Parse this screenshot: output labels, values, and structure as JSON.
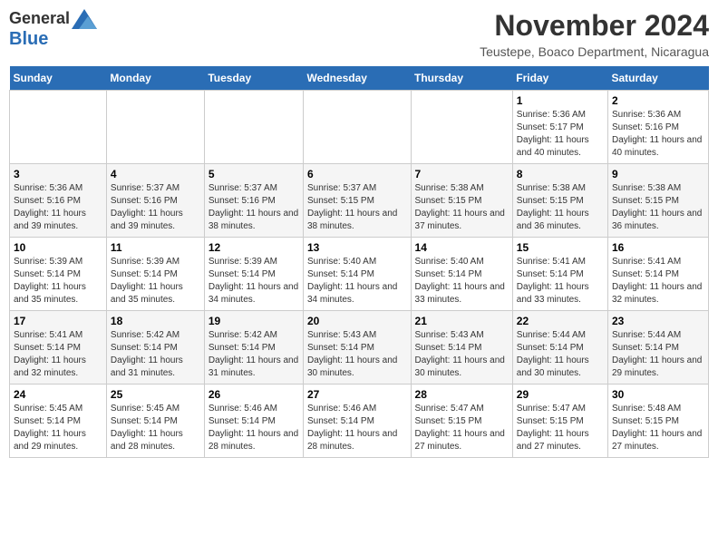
{
  "logo": {
    "line1": "General",
    "line2": "Blue"
  },
  "title": "November 2024",
  "subtitle": "Teustepe, Boaco Department, Nicaragua",
  "weekdays": [
    "Sunday",
    "Monday",
    "Tuesday",
    "Wednesday",
    "Thursday",
    "Friday",
    "Saturday"
  ],
  "weeks": [
    [
      {
        "day": "",
        "info": ""
      },
      {
        "day": "",
        "info": ""
      },
      {
        "day": "",
        "info": ""
      },
      {
        "day": "",
        "info": ""
      },
      {
        "day": "",
        "info": ""
      },
      {
        "day": "1",
        "info": "Sunrise: 5:36 AM\nSunset: 5:17 PM\nDaylight: 11 hours and 40 minutes."
      },
      {
        "day": "2",
        "info": "Sunrise: 5:36 AM\nSunset: 5:16 PM\nDaylight: 11 hours and 40 minutes."
      }
    ],
    [
      {
        "day": "3",
        "info": "Sunrise: 5:36 AM\nSunset: 5:16 PM\nDaylight: 11 hours and 39 minutes."
      },
      {
        "day": "4",
        "info": "Sunrise: 5:37 AM\nSunset: 5:16 PM\nDaylight: 11 hours and 39 minutes."
      },
      {
        "day": "5",
        "info": "Sunrise: 5:37 AM\nSunset: 5:16 PM\nDaylight: 11 hours and 38 minutes."
      },
      {
        "day": "6",
        "info": "Sunrise: 5:37 AM\nSunset: 5:15 PM\nDaylight: 11 hours and 38 minutes."
      },
      {
        "day": "7",
        "info": "Sunrise: 5:38 AM\nSunset: 5:15 PM\nDaylight: 11 hours and 37 minutes."
      },
      {
        "day": "8",
        "info": "Sunrise: 5:38 AM\nSunset: 5:15 PM\nDaylight: 11 hours and 36 minutes."
      },
      {
        "day": "9",
        "info": "Sunrise: 5:38 AM\nSunset: 5:15 PM\nDaylight: 11 hours and 36 minutes."
      }
    ],
    [
      {
        "day": "10",
        "info": "Sunrise: 5:39 AM\nSunset: 5:14 PM\nDaylight: 11 hours and 35 minutes."
      },
      {
        "day": "11",
        "info": "Sunrise: 5:39 AM\nSunset: 5:14 PM\nDaylight: 11 hours and 35 minutes."
      },
      {
        "day": "12",
        "info": "Sunrise: 5:39 AM\nSunset: 5:14 PM\nDaylight: 11 hours and 34 minutes."
      },
      {
        "day": "13",
        "info": "Sunrise: 5:40 AM\nSunset: 5:14 PM\nDaylight: 11 hours and 34 minutes."
      },
      {
        "day": "14",
        "info": "Sunrise: 5:40 AM\nSunset: 5:14 PM\nDaylight: 11 hours and 33 minutes."
      },
      {
        "day": "15",
        "info": "Sunrise: 5:41 AM\nSunset: 5:14 PM\nDaylight: 11 hours and 33 minutes."
      },
      {
        "day": "16",
        "info": "Sunrise: 5:41 AM\nSunset: 5:14 PM\nDaylight: 11 hours and 32 minutes."
      }
    ],
    [
      {
        "day": "17",
        "info": "Sunrise: 5:41 AM\nSunset: 5:14 PM\nDaylight: 11 hours and 32 minutes."
      },
      {
        "day": "18",
        "info": "Sunrise: 5:42 AM\nSunset: 5:14 PM\nDaylight: 11 hours and 31 minutes."
      },
      {
        "day": "19",
        "info": "Sunrise: 5:42 AM\nSunset: 5:14 PM\nDaylight: 11 hours and 31 minutes."
      },
      {
        "day": "20",
        "info": "Sunrise: 5:43 AM\nSunset: 5:14 PM\nDaylight: 11 hours and 30 minutes."
      },
      {
        "day": "21",
        "info": "Sunrise: 5:43 AM\nSunset: 5:14 PM\nDaylight: 11 hours and 30 minutes."
      },
      {
        "day": "22",
        "info": "Sunrise: 5:44 AM\nSunset: 5:14 PM\nDaylight: 11 hours and 30 minutes."
      },
      {
        "day": "23",
        "info": "Sunrise: 5:44 AM\nSunset: 5:14 PM\nDaylight: 11 hours and 29 minutes."
      }
    ],
    [
      {
        "day": "24",
        "info": "Sunrise: 5:45 AM\nSunset: 5:14 PM\nDaylight: 11 hours and 29 minutes."
      },
      {
        "day": "25",
        "info": "Sunrise: 5:45 AM\nSunset: 5:14 PM\nDaylight: 11 hours and 28 minutes."
      },
      {
        "day": "26",
        "info": "Sunrise: 5:46 AM\nSunset: 5:14 PM\nDaylight: 11 hours and 28 minutes."
      },
      {
        "day": "27",
        "info": "Sunrise: 5:46 AM\nSunset: 5:14 PM\nDaylight: 11 hours and 28 minutes."
      },
      {
        "day": "28",
        "info": "Sunrise: 5:47 AM\nSunset: 5:15 PM\nDaylight: 11 hours and 27 minutes."
      },
      {
        "day": "29",
        "info": "Sunrise: 5:47 AM\nSunset: 5:15 PM\nDaylight: 11 hours and 27 minutes."
      },
      {
        "day": "30",
        "info": "Sunrise: 5:48 AM\nSunset: 5:15 PM\nDaylight: 11 hours and 27 minutes."
      }
    ]
  ]
}
